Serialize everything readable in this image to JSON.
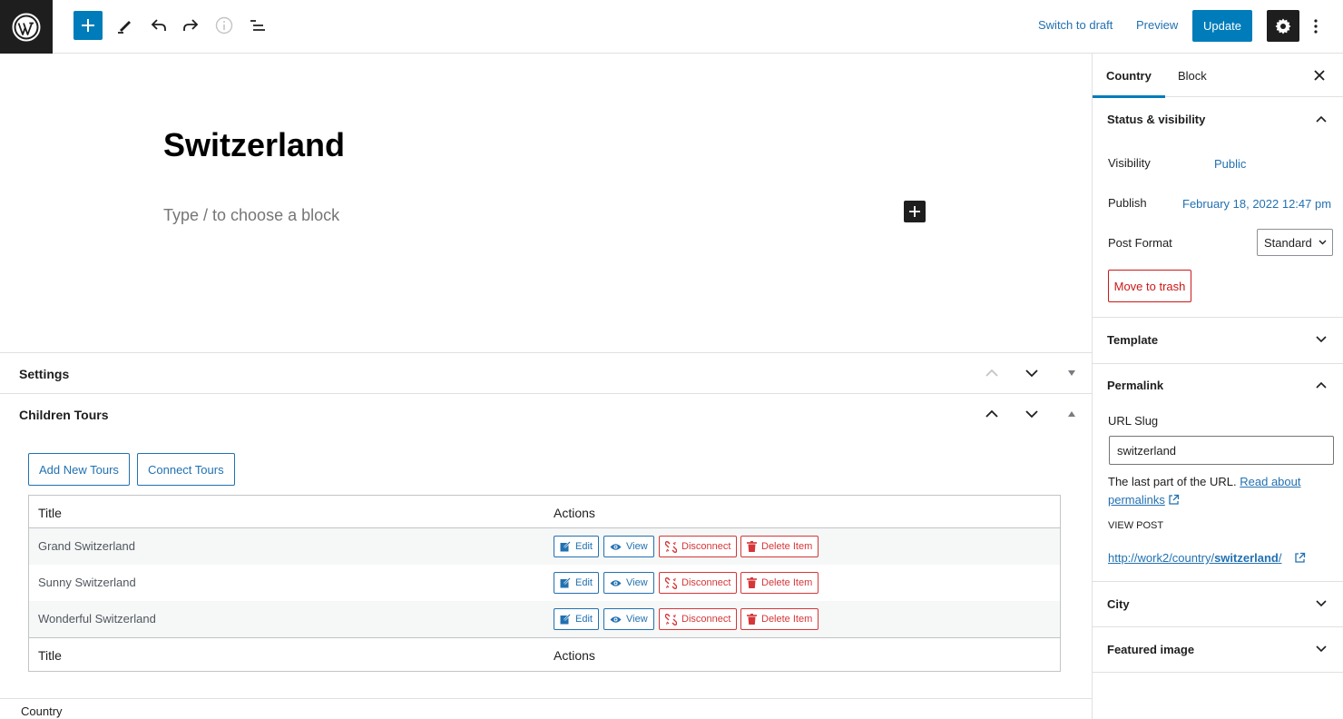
{
  "toolbar": {
    "switch_to_draft": "Switch to draft",
    "preview": "Preview",
    "update": "Update"
  },
  "editor": {
    "post_title": "Switzerland",
    "block_placeholder": "Type / to choose a block"
  },
  "metaboxes": {
    "settings": {
      "title": "Settings"
    },
    "children_tours": {
      "title": "Children Tours",
      "add_new_label": "Add New Tours",
      "connect_label": "Connect Tours",
      "table": {
        "header": {
          "title": "Title",
          "actions": "Actions"
        },
        "footer": {
          "title": "Title",
          "actions": "Actions"
        },
        "rows": [
          {
            "title": "Grand Switzerland"
          },
          {
            "title": "Sunny Switzerland"
          },
          {
            "title": "Wonderful Switzerland"
          }
        ],
        "actions": {
          "edit": "Edit",
          "view": "View",
          "disconnect": "Disconnect",
          "delete": "Delete Item"
        }
      }
    }
  },
  "footer": {
    "breadcrumb": "Country"
  },
  "sidebar": {
    "tabs": {
      "post": "Country",
      "block": "Block"
    },
    "status_visibility": {
      "title": "Status & visibility",
      "visibility_label": "Visibility",
      "visibility_value": "Public",
      "publish_label": "Publish",
      "publish_value": "February 18, 2022 12:47 pm",
      "post_format_label": "Post Format",
      "post_format_value": "Standard",
      "trash_label": "Move to trash"
    },
    "template": {
      "title": "Template"
    },
    "permalink": {
      "title": "Permalink",
      "url_slug_label": "URL Slug",
      "url_slug_value": "switzerland",
      "help_text": "The last part of the URL.",
      "help_link": "Read about permalinks",
      "view_post_label": "VIEW POST",
      "post_url_prefix": "http://work2/country/",
      "post_url_slug": "switzerland",
      "post_url_suffix": "/"
    },
    "city": {
      "title": "City"
    },
    "featured_image": {
      "title": "Featured image"
    }
  },
  "colors": {
    "accent": "#007cba",
    "link": "#2271b1",
    "danger": "#cc1818",
    "dark": "#1e1e1e"
  }
}
